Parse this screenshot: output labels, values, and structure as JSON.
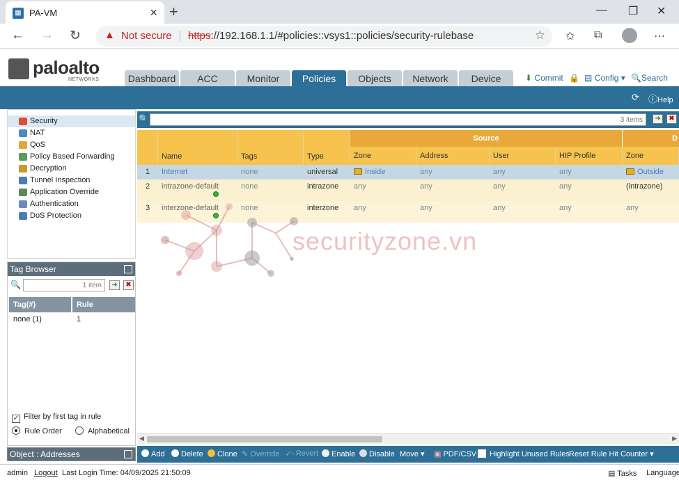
{
  "browser": {
    "tab_title": "PA-VM",
    "security_label": "Not secure",
    "url_protocol": "https",
    "url_rest": "://192.168.1.1/#policies::vsys1::policies/security-rulebase"
  },
  "app": {
    "logo_text": "paloalto",
    "logo_sub": "NETWORKS",
    "nav_tabs": [
      "Dashboard",
      "ACC",
      "Monitor",
      "Policies",
      "Objects",
      "Network",
      "Device"
    ],
    "active_tab": "Policies",
    "commit_label": "Commit",
    "config_label": "Config",
    "search_label": "Search",
    "help_label": "Help"
  },
  "sidebar": {
    "items": [
      {
        "label": "Security",
        "icon": "security-icon",
        "color": "#d9502f"
      },
      {
        "label": "NAT",
        "icon": "nat-icon",
        "color": "#4a8ac7"
      },
      {
        "label": "QoS",
        "icon": "qos-icon",
        "color": "#e8a23a"
      },
      {
        "label": "Policy Based Forwarding",
        "icon": "pbf-icon",
        "color": "#5a9a5a"
      },
      {
        "label": "Decryption",
        "icon": "decryption-icon",
        "color": "#c89a2a"
      },
      {
        "label": "Tunnel Inspection",
        "icon": "tunnel-icon",
        "color": "#4a7eb0"
      },
      {
        "label": "Application Override",
        "icon": "app-override-icon",
        "color": "#5a8a5a"
      },
      {
        "label": "Authentication",
        "icon": "authentication-icon",
        "color": "#6a8ac0"
      },
      {
        "label": "DoS Protection",
        "icon": "dos-icon",
        "color": "#4a7eb0"
      }
    ]
  },
  "tag_browser": {
    "title": "Tag Browser",
    "search_count": "1 item",
    "col_tag": "Tag(#)",
    "col_rule": "Rule",
    "rows": [
      {
        "tag": "none (1)",
        "rule": "1"
      }
    ],
    "filter_label": "Filter by first tag in rule",
    "order_rule": "Rule Order",
    "order_alpha": "Alphabetical"
  },
  "object_bar": {
    "label": "Object : Addresses"
  },
  "rules": {
    "count_label": "3 items",
    "group_source": "Source",
    "group_destination_partial": "D",
    "columns": {
      "name": "Name",
      "tags": "Tags",
      "type": "Type",
      "zone": "Zone",
      "address": "Address",
      "user": "User",
      "hip": "HIP Profile",
      "dzone": "Zone"
    },
    "rows": [
      {
        "num": "1",
        "name": "Internet",
        "tags": "none",
        "type": "universal",
        "zone": "Inside",
        "address": "any",
        "user": "any",
        "hip": "any",
        "dzone": "Outside"
      },
      {
        "num": "2",
        "name": "intrazone-default",
        "tags": "none",
        "type": "intrazone",
        "zone": "any",
        "address": "any",
        "user": "any",
        "hip": "any",
        "dzone": "(intrazone)"
      },
      {
        "num": "3",
        "name": "interzone-default",
        "tags": "none",
        "type": "interzone",
        "zone": "any",
        "address": "any",
        "user": "any",
        "hip": "any",
        "dzone": "any"
      }
    ]
  },
  "watermark": "securityzone.vn",
  "actions": {
    "add": "Add",
    "delete": "Delete",
    "clone": "Clone",
    "override": "Override",
    "revert": "Revert",
    "enable": "Enable",
    "disable": "Disable",
    "move": "Move",
    "pdf": "PDF/CSV",
    "highlight": "Highlight Unused Rules",
    "reset": "Reset Rule Hit Counter"
  },
  "status": {
    "user": "admin",
    "logout": "Logout",
    "last_login": "Last Login Time: 04/09/2025 21:50:09",
    "tasks": "Tasks",
    "language": "Language"
  },
  "colors": {
    "accent": "#2c6f97",
    "header_yellow": "#f5c34e",
    "row_selected": "#c6d7e4",
    "row_alt": "#fbf0cf"
  }
}
